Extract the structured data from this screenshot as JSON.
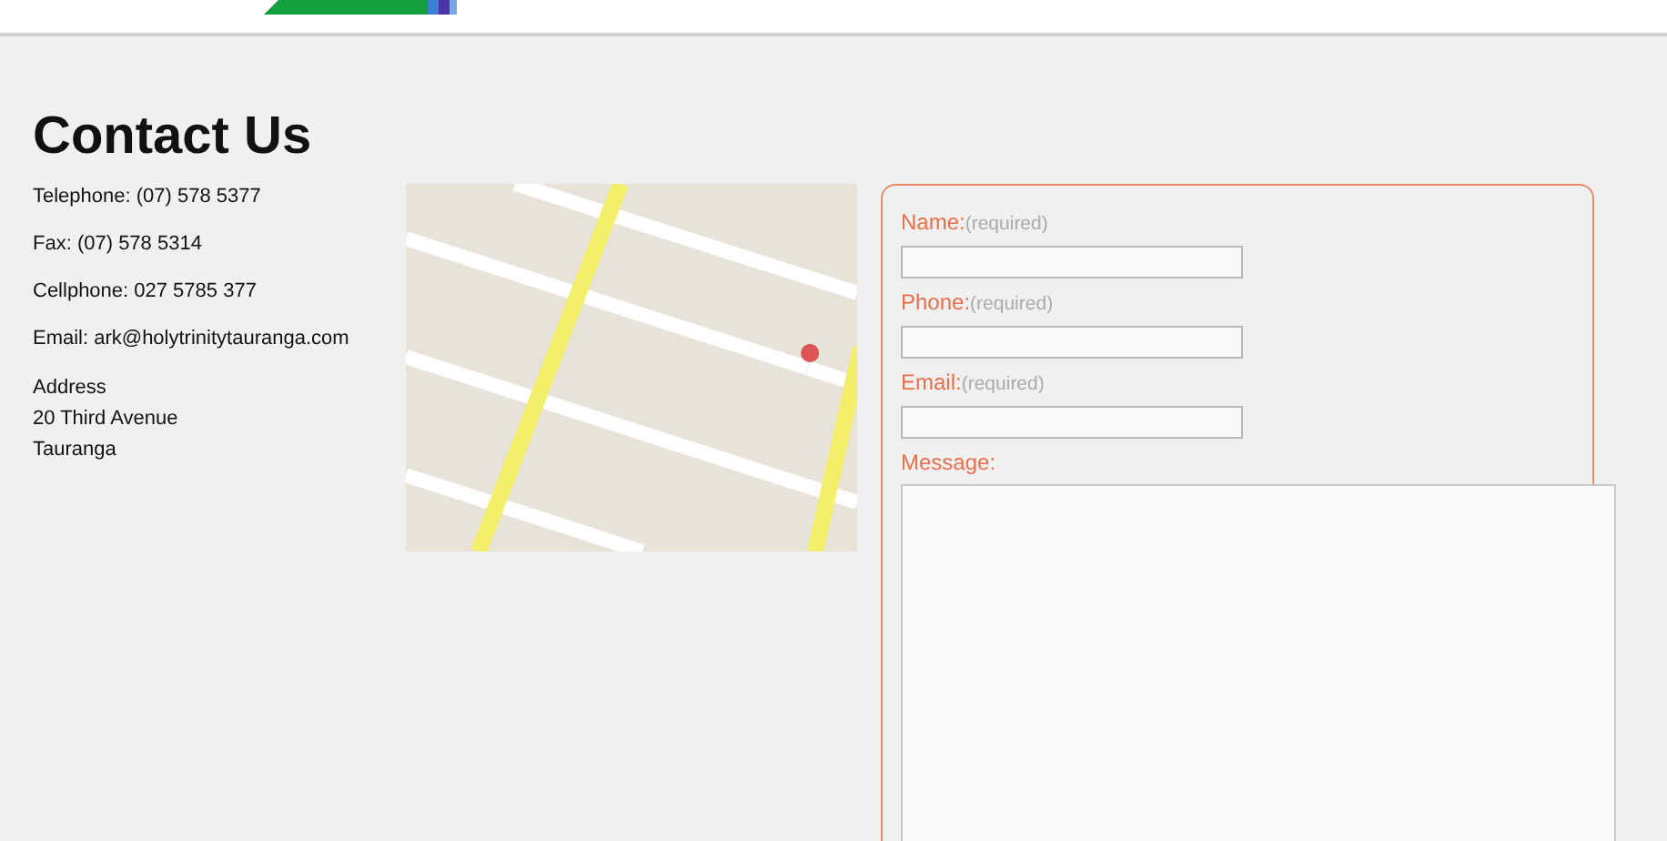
{
  "heading": "Contact Us",
  "contact_lines": [
    "Telephone: (07) 578 5377",
    "Fax: (07) 578 5314",
    "Cellphone: 027 5785 377",
    "Email: ark@holytrinitytauranga.com"
  ],
  "address": [
    "Address",
    "20 Third Avenue",
    "Tauranga"
  ],
  "form": {
    "fields": [
      {
        "kind": "input",
        "label": "Name:",
        "note": "(required)"
      },
      {
        "kind": "input",
        "label": "Phone:",
        "note": "(required)"
      },
      {
        "kind": "input",
        "label": "Email:",
        "note": "(required)"
      },
      {
        "kind": "textarea",
        "label": "Message:"
      }
    ]
  }
}
